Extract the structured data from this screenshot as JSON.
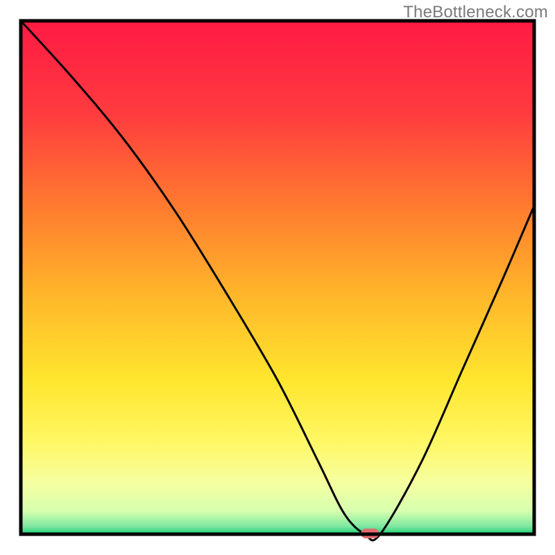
{
  "attribution": "TheBottleneck.com",
  "chart_data": {
    "type": "line",
    "title": "",
    "xlabel": "",
    "ylabel": "",
    "xlim": [
      0,
      100
    ],
    "ylim": [
      0,
      100
    ],
    "series": [
      {
        "name": "bottleneck-curve",
        "x": [
          0,
          10,
          20,
          30,
          40,
          50,
          58,
          63,
          67,
          70,
          78,
          86,
          94,
          100
        ],
        "y": [
          100,
          89,
          77,
          63,
          47,
          30,
          14,
          4,
          0,
          0,
          14,
          32,
          50,
          64
        ]
      }
    ],
    "optimal_marker": {
      "x": 68,
      "y": 0
    },
    "gradient_stops": [
      {
        "pct": 0.0,
        "color": "#ff1a44"
      },
      {
        "pct": 0.18,
        "color": "#ff3b3f"
      },
      {
        "pct": 0.36,
        "color": "#ff7a2f"
      },
      {
        "pct": 0.54,
        "color": "#ffb82a"
      },
      {
        "pct": 0.7,
        "color": "#ffe62e"
      },
      {
        "pct": 0.82,
        "color": "#fff765"
      },
      {
        "pct": 0.9,
        "color": "#f6ffa0"
      },
      {
        "pct": 0.955,
        "color": "#d7ffb0"
      },
      {
        "pct": 0.985,
        "color": "#7de8a0"
      },
      {
        "pct": 1.0,
        "color": "#18cf76"
      }
    ],
    "marker_color": "#e46a6e",
    "curve_color": "#000000",
    "frame_color": "#000000"
  }
}
